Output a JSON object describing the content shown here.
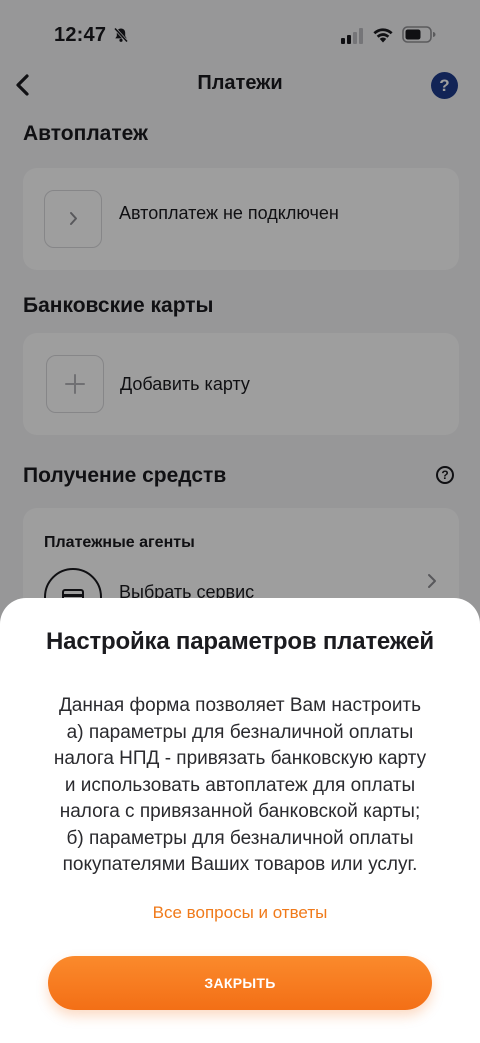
{
  "status_bar": {
    "time": "12:47"
  },
  "header": {
    "title": "Платежи",
    "help_label": "?"
  },
  "autopay": {
    "section_title": "Автоплатеж",
    "status_label": "Автоплатеж не подключен"
  },
  "bank_cards": {
    "section_title": "Банковские карты",
    "add_label": "Добавить карту"
  },
  "receiving": {
    "section_title": "Получение средств",
    "info_label": "?",
    "agents_title": "Платежные агенты",
    "choose_service_label": "Выбрать сервис"
  },
  "sheet": {
    "title": "Настройка параметров платежей",
    "body": "Данная форма позволяет Вам настроить\nа) параметры для безналичной оплаты\nналога НПД - привязать банковскую карту\nи использовать автоплатеж для оплаты\nналога с привязанной банковской карты;\nб) параметры для безналичной оплаты\nпокупателями Ваших товаров или услуг.",
    "faq_link": "Все вопросы и ответы",
    "close_button": "ЗАКРЫТЬ"
  },
  "colors": {
    "accent_orange": "#f36f16",
    "help_blue": "#1d3b8c"
  }
}
